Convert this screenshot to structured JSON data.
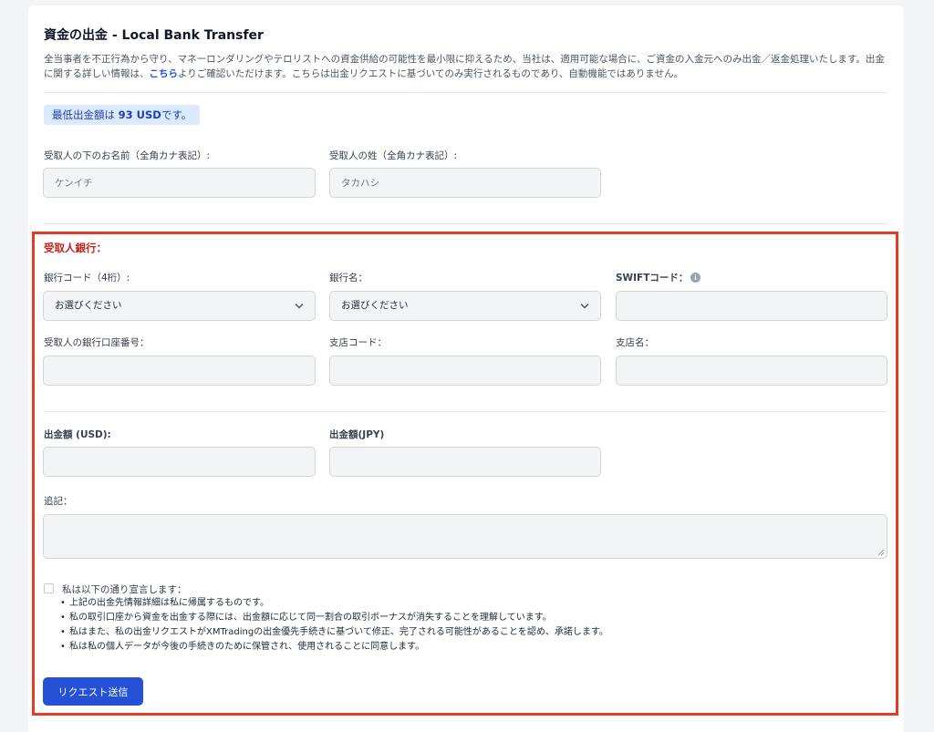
{
  "header": {
    "title": "資金の出金 - Local Bank Transfer",
    "intro_part1": "全当事者を不正行為から守り、マネーロンダリングやテロリストへの資金供給の可能性を最小限に抑えるため、当社は、適用可能な場合に、ご資金の入金元へのみ出金／返金処理いたします。出金に関する詳しい情報は、",
    "intro_link": "こちら",
    "intro_part2": "よりご確認いただけます。こちらは出金リクエストに基づいてのみ実行されるものであり、自動機能ではありません。"
  },
  "min_amount": {
    "prefix": "最低出金額は ",
    "amount": "93 USD",
    "suffix": "です。"
  },
  "recipient": {
    "first_name_label": "受取人の下のお名前（全角カナ表記）:",
    "first_name_placeholder": "ケンイチ",
    "last_name_label": "受取人の姓（全角カナ表記）:",
    "last_name_placeholder": "タカハシ"
  },
  "bank": {
    "section_title": "受取人銀行：",
    "bank_code_label": "銀行コード（4桁）:",
    "bank_code_value": "お選びください",
    "bank_name_label": "銀行名：",
    "bank_name_value": "お選びください",
    "swift_label": "SWIFTコード：",
    "account_number_label": "受取人の銀行口座番号：",
    "branch_code_label": "支店コード：",
    "branch_name_label": "支店名："
  },
  "amounts": {
    "usd_label": "出金額 (USD):",
    "jpy_label": "出金額(JPY)",
    "notes_label": "追記："
  },
  "declaration": {
    "title": "私は以下の通り宣言します：",
    "items": [
      "上記の出金先情報詳細は私に帰属するものです。",
      "私の取引口座から資金を出金する際には、出金額に応じて同一割合の取引ボーナスが消失することを理解しています。",
      "私はまた、私の出金リクエストがXMTradingの出金優先手続きに基づいて修正、完了される可能性があることを認め、承諾します。",
      "私は私の個人データが今後の手続きのために保管され、使用されることに同意します。"
    ]
  },
  "submit_label": "リクエスト送信",
  "colors": {
    "accent": "#2451d6",
    "highlight_frame": "#e63a25",
    "section_title": "#c5221f",
    "min_box_bg": "#dbeafe"
  }
}
